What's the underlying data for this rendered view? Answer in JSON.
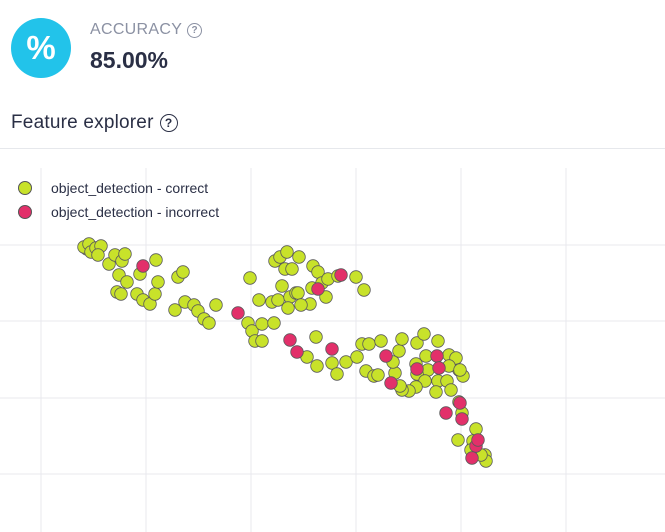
{
  "metric": {
    "icon": "percent-icon",
    "icon_glyph": "%",
    "label": "ACCURACY",
    "value": "85.00%",
    "accent": "#22c3ea"
  },
  "section": {
    "title": "Feature explorer"
  },
  "chart_data": {
    "type": "scatter",
    "grid": true,
    "series": [
      {
        "name": "object_detection - correct",
        "color": "#c8e22a",
        "points": [
          [
            87,
            249
          ],
          [
            84,
            247
          ],
          [
            89,
            244
          ],
          [
            91,
            252
          ],
          [
            96,
            248
          ],
          [
            101,
            246
          ],
          [
            98,
            255
          ],
          [
            109,
            264
          ],
          [
            115,
            255
          ],
          [
            122,
            261
          ],
          [
            125,
            254
          ],
          [
            119,
            275
          ],
          [
            127,
            282
          ],
          [
            117,
            292
          ],
          [
            121,
            294
          ],
          [
            137,
            294
          ],
          [
            143,
            300
          ],
          [
            150,
            304
          ],
          [
            155,
            294
          ],
          [
            158,
            282
          ],
          [
            156,
            260
          ],
          [
            140,
            274
          ],
          [
            178,
            277
          ],
          [
            183,
            272
          ],
          [
            185,
            302
          ],
          [
            175,
            310
          ],
          [
            194,
            305
          ],
          [
            198,
            311
          ],
          [
            204,
            319
          ],
          [
            209,
            323
          ],
          [
            216,
            305
          ],
          [
            250,
            278
          ],
          [
            248,
            323
          ],
          [
            252,
            331
          ],
          [
            255,
            341
          ],
          [
            262,
            341
          ],
          [
            262,
            324
          ],
          [
            274,
            323
          ],
          [
            259,
            300
          ],
          [
            272,
            302
          ],
          [
            278,
            300
          ],
          [
            290,
            297
          ],
          [
            288,
            308
          ],
          [
            296,
            293
          ],
          [
            282,
            286
          ],
          [
            298,
            293
          ],
          [
            275,
            261
          ],
          [
            280,
            257
          ],
          [
            287,
            252
          ],
          [
            299,
            257
          ],
          [
            285,
            269
          ],
          [
            292,
            269
          ],
          [
            313,
            266
          ],
          [
            318,
            272
          ],
          [
            312,
            288
          ],
          [
            322,
            283
          ],
          [
            328,
            279
          ],
          [
            338,
            276
          ],
          [
            356,
            277
          ],
          [
            364,
            290
          ],
          [
            326,
            297
          ],
          [
            310,
            304
          ],
          [
            301,
            305
          ],
          [
            316,
            337
          ],
          [
            307,
            357
          ],
          [
            317,
            366
          ],
          [
            332,
            363
          ],
          [
            337,
            374
          ],
          [
            346,
            362
          ],
          [
            357,
            357
          ],
          [
            362,
            344
          ],
          [
            369,
            344
          ],
          [
            381,
            341
          ],
          [
            366,
            371
          ],
          [
            374,
            376
          ],
          [
            378,
            375
          ],
          [
            395,
            373
          ],
          [
            393,
            362
          ],
          [
            399,
            351
          ],
          [
            402,
            339
          ],
          [
            417,
            343
          ],
          [
            424,
            334
          ],
          [
            438,
            341
          ],
          [
            416,
            364
          ],
          [
            426,
            356
          ],
          [
            428,
            370
          ],
          [
            449,
            355
          ],
          [
            456,
            358
          ],
          [
            459,
            370
          ],
          [
            463,
            376
          ],
          [
            449,
            366
          ],
          [
            438,
            381
          ],
          [
            447,
            381
          ],
          [
            417,
            374
          ],
          [
            425,
            381
          ],
          [
            416,
            387
          ],
          [
            409,
            391
          ],
          [
            402,
            390
          ],
          [
            400,
            386
          ],
          [
            436,
            392
          ],
          [
            460,
            370
          ],
          [
            462,
            413
          ],
          [
            476,
            429
          ],
          [
            458,
            440
          ],
          [
            473,
            447
          ],
          [
            485,
            455
          ],
          [
            486,
            461
          ],
          [
            481,
            455
          ],
          [
            473,
            441
          ],
          [
            459,
            402
          ],
          [
            471,
            450
          ],
          [
            451,
            390
          ]
        ]
      },
      {
        "name": "object_detection - incorrect",
        "color": "#e2306a",
        "points": [
          [
            143,
            266
          ],
          [
            238,
            313
          ],
          [
            290,
            340
          ],
          [
            297,
            352
          ],
          [
            318,
            289
          ],
          [
            341,
            275
          ],
          [
            332,
            349
          ],
          [
            386,
            356
          ],
          [
            391,
            383
          ],
          [
            417,
            369
          ],
          [
            437,
            356
          ],
          [
            439,
            368
          ],
          [
            446,
            413
          ],
          [
            460,
            403
          ],
          [
            462,
            419
          ],
          [
            476,
            446
          ],
          [
            478,
            440
          ],
          [
            472,
            458
          ]
        ]
      }
    ],
    "gridlines_x": [
      41,
      146,
      251,
      356,
      461,
      566
    ],
    "gridlines_y": [
      245,
      321,
      398,
      474
    ]
  }
}
